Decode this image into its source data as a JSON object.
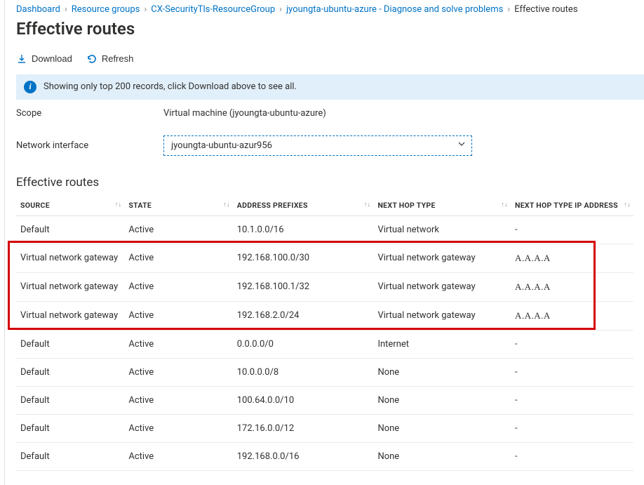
{
  "breadcrumb": {
    "dashboard": "Dashboard",
    "rg": "Resource groups",
    "rg_name": "CX-SecurityTls-ResourceGroup",
    "vm": "jyoungta-ubuntu-azure - Diagnose and solve problems",
    "current": "Effective routes"
  },
  "page_title": "Effective routes",
  "toolbar": {
    "download": "Download",
    "refresh": "Refresh"
  },
  "banner": {
    "text": "Showing only top 200 records, click Download above to see all."
  },
  "form": {
    "scope_label": "Scope",
    "scope_value": "Virtual machine (jyoungta-ubuntu-azure)",
    "nic_label": "Network interface",
    "nic_value": "jyoungta-ubuntu-azur956"
  },
  "section_title": "Effective routes",
  "columns": {
    "source": "SOURCE",
    "state": "STATE",
    "prefix": "ADDRESS PREFIXES",
    "nht": "NEXT HOP TYPE",
    "nhip": "NEXT HOP TYPE IP ADDRESS"
  },
  "rows": [
    {
      "source": "Default",
      "state": "Active",
      "prefix": "10.1.0.0/16",
      "nht": "Virtual network",
      "nhip": "-",
      "hl": false,
      "fancy": false
    },
    {
      "source": "Virtual network gateway",
      "state": "Active",
      "prefix": "192.168.100.0/30",
      "nht": "Virtual network gateway",
      "nhip": "A.A.A.A",
      "hl": true,
      "fancy": true
    },
    {
      "source": "Virtual network gateway",
      "state": "Active",
      "prefix": "192.168.100.1/32",
      "nht": "Virtual network gateway",
      "nhip": "A.A.A.A",
      "hl": true,
      "fancy": true
    },
    {
      "source": "Virtual network gateway",
      "state": "Active",
      "prefix": "192.168.2.0/24",
      "nht": "Virtual network gateway",
      "nhip": "A.A.A.A",
      "hl": true,
      "fancy": true
    },
    {
      "source": "Default",
      "state": "Active",
      "prefix": "0.0.0.0/0",
      "nht": "Internet",
      "nhip": "-",
      "hl": false,
      "fancy": false
    },
    {
      "source": "Default",
      "state": "Active",
      "prefix": "10.0.0.0/8",
      "nht": "None",
      "nhip": "-",
      "hl": false,
      "fancy": false
    },
    {
      "source": "Default",
      "state": "Active",
      "prefix": "100.64.0.0/10",
      "nht": "None",
      "nhip": "-",
      "hl": false,
      "fancy": false
    },
    {
      "source": "Default",
      "state": "Active",
      "prefix": "172.16.0.0/12",
      "nht": "None",
      "nhip": "-",
      "hl": false,
      "fancy": false
    },
    {
      "source": "Default",
      "state": "Active",
      "prefix": "192.168.0.0/16",
      "nht": "None",
      "nhip": "-",
      "hl": false,
      "fancy": false
    }
  ]
}
